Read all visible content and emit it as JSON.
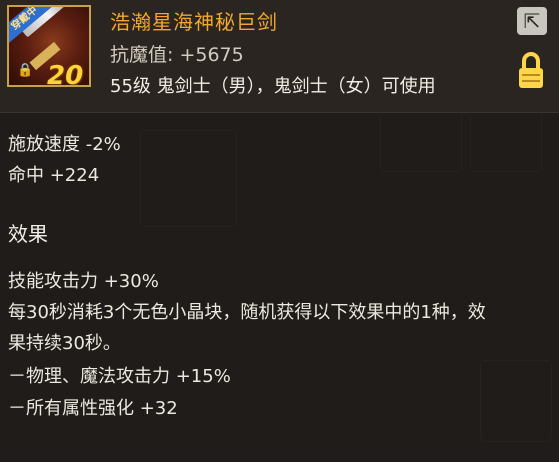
{
  "item": {
    "name": "浩瀚星海神秘巨剑",
    "badge": "穿戴中",
    "level_display": "20",
    "stat": "抗魔值: +5675",
    "class_requirement": "55级 鬼剑士（男），鬼剑士（女）可使用"
  },
  "icons": {
    "export": "share-export-icon",
    "lock": "lock-icon",
    "small_lock": "lock-icon"
  },
  "stats": [
    "施放速度 -2%",
    "命中 +224"
  ],
  "effect": {
    "title": "效果",
    "lines": [
      "技能攻击力 +30%",
      "每30秒消耗3个无色小晶块，随机获得以下效果中的1种，效",
      "果持续30秒。",
      "－物理、魔法攻击力 +15%",
      "－所有属性强化 +32"
    ]
  },
  "colors": {
    "title": "#f3a630",
    "lock": "#ffd54a",
    "background": "#1f1c19"
  }
}
